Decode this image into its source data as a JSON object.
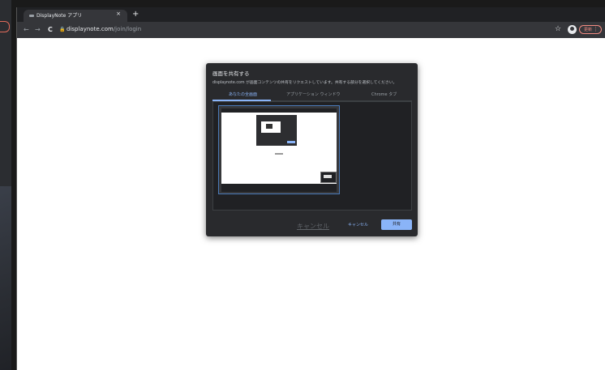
{
  "browser": {
    "tab": {
      "title": "DisplayNote アプリ",
      "close": "×"
    },
    "new_tab": "+",
    "nav": {
      "back": "←",
      "forward": "→",
      "reload": "C"
    },
    "lock_icon": "🔒",
    "url": {
      "host": "displaynote.com",
      "path": "/join/login"
    },
    "star": "☆",
    "update": {
      "label": "更新",
      "menu": "⋮"
    }
  },
  "dialog": {
    "title": "画面を共有する",
    "subtitle": "displaynote.com が画面コンテンツの共有をリクエストしています。共有する部分を選択してください。",
    "tabs": [
      {
        "label": "あなたの全画面",
        "active": true
      },
      {
        "label": "アプリケーション ウィンドウ",
        "active": false
      },
      {
        "label": "Chrome タブ",
        "active": false
      }
    ],
    "cancel_label": "キャンセル",
    "share_label": "共有"
  },
  "page": {
    "cancel_link": "キャンセル"
  },
  "colors": {
    "accent": "#8ab4f8",
    "dialog_bg": "#292a2d",
    "update": "#f28b82"
  }
}
